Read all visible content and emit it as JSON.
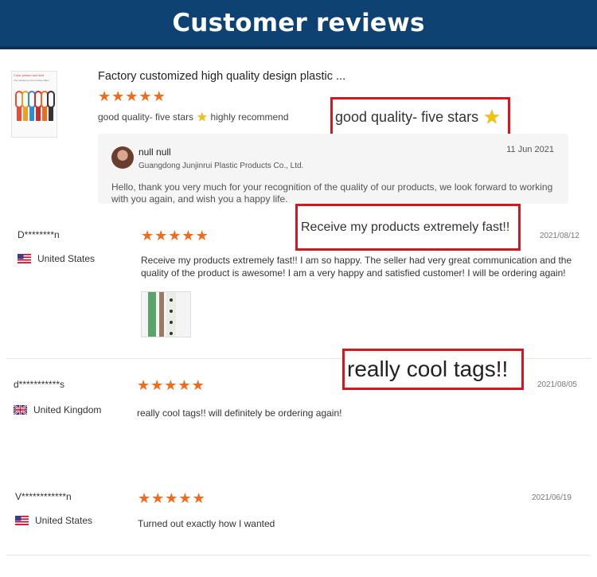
{
  "header": {
    "title": "Customer reviews"
  },
  "product": {
    "thumb_caption": "Color picture and text",
    "thumb_caption2": "The following is the printing effect",
    "title": "Factory customized high quality design plastic ...",
    "stars": 5,
    "review_text": "good quality- five stars",
    "review_suffix": "highly recommend",
    "highlight": "good quality- five stars"
  },
  "reply": {
    "name": "null null",
    "company": "Guangdong Junjinrui Plastic Products Co., Ltd.",
    "date": "11 Jun 2021",
    "text": "Hello, thank you very much for your recognition of the quality of our products, we look forward to working with you again, and wish you a happy life."
  },
  "reviews": [
    {
      "user": "D********n",
      "country": "United States",
      "flag": "us",
      "stars": 5,
      "date": "2021/08/12",
      "text": "Receive my products extremely fast!! I am so happy. The seller had very great communication and the quality of the product is awesome! I am a very happy and satisfied customer! I will be ordering again!",
      "highlight": "Receive my products extremely fast!!"
    },
    {
      "user": "d***********s",
      "country": "United Kingdom",
      "flag": "gb",
      "stars": 5,
      "date": "2021/08/05",
      "text": "really cool tags!! will definitely be ordering again!",
      "highlight": "really cool tags!!"
    },
    {
      "user": "V************n",
      "country": "United States",
      "flag": "us",
      "stars": 5,
      "date": "2021/06/19",
      "text": "Turned out exactly how I wanted"
    }
  ],
  "icons": {
    "star": "★",
    "star_emoji": "★"
  },
  "colors": {
    "header_bg": "#0e4272",
    "star": "#f26b1d",
    "highlight_border": "#d8141c"
  }
}
